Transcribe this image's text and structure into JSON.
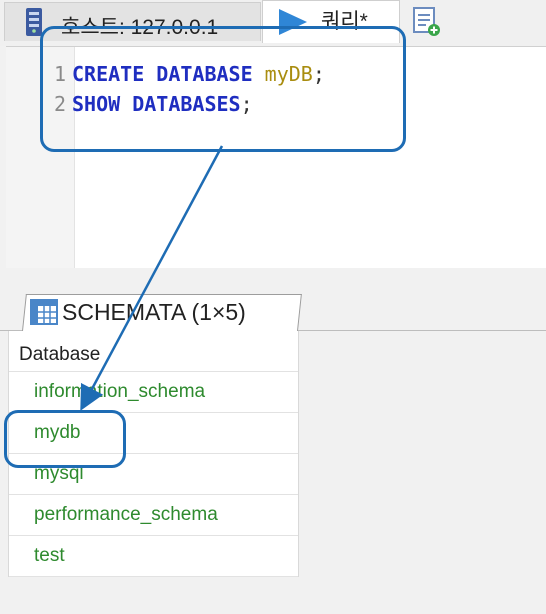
{
  "tabs": {
    "host_label": "호스트: 127.0.0.1",
    "query_label": "쿼리*"
  },
  "editor": {
    "lines": [
      {
        "number": "1",
        "tokens": {
          "kw1": "CREATE",
          "kw2": "DATABASE",
          "ident": "myDB",
          "punct": ";"
        }
      },
      {
        "number": "2",
        "tokens": {
          "kw1": "SHOW",
          "kw2": "DATABASES",
          "punct": ";"
        }
      }
    ]
  },
  "result": {
    "tab_label": "SCHEMATA (1×5)",
    "column_header": "Database",
    "rows": [
      "information_schema",
      "mydb",
      "mysql",
      "performance_schema",
      "test"
    ]
  },
  "colors": {
    "keyword": "#1f2ec0",
    "identifier": "#a98d10",
    "result_text": "#2e8a2e",
    "annotation": "#1e6cb4"
  },
  "icons": {
    "server": "server-icon",
    "run": "play-icon",
    "new_query": "new-query-icon",
    "result_grid": "grid-icon"
  }
}
